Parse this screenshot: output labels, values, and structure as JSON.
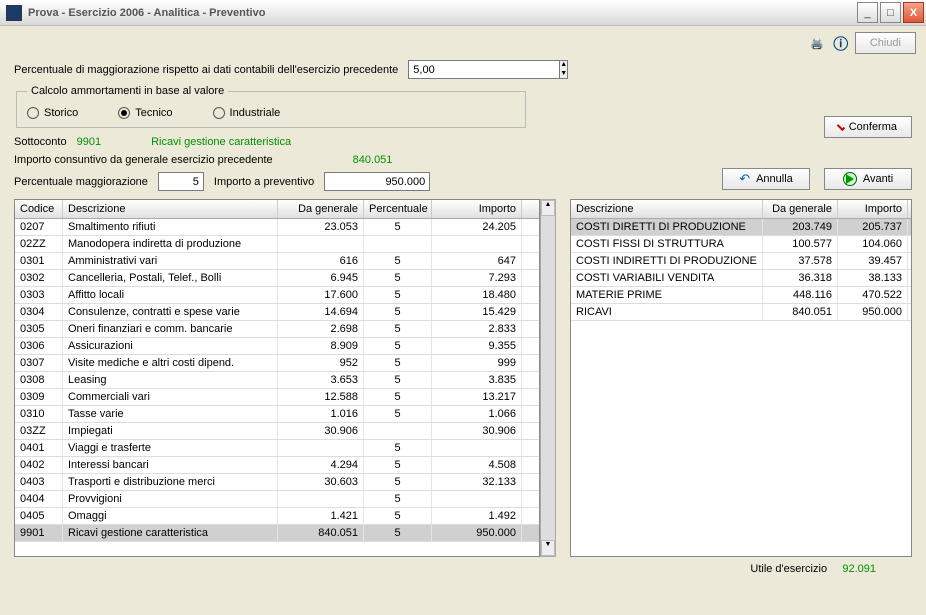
{
  "window": {
    "title": "Prova - Esercizio 2006 - Analitica - Preventivo"
  },
  "toolbar": {
    "chiudi": "Chiudi"
  },
  "form": {
    "perc_label": "Percentuale di maggiorazione rispetto ai dati contabili dell'esercizio precedente",
    "perc_value": "5,00",
    "fieldset_legend": "Calcolo ammortamenti in base al valore",
    "radio_storico": "Storico",
    "radio_tecnico": "Tecnico",
    "radio_industriale": "Industriale",
    "sottoconto_label": "Sottoconto",
    "sottoconto_code": "9901",
    "sottoconto_desc": "Ricavi gestione caratteristica",
    "importo_consuntivo_label": "Importo consuntivo da generale esercizio precedente",
    "importo_consuntivo_value": "840.051",
    "perc_magg_label": "Percentuale maggiorazione",
    "perc_magg_value": "5",
    "importo_prev_label": "Importo a preventivo",
    "importo_prev_value": "950.000"
  },
  "buttons": {
    "conferma": "Conferma",
    "annulla": "Annulla",
    "avanti": "Avanti"
  },
  "left_table": {
    "headers": [
      "Codice",
      "Descrizione",
      "Da generale",
      "Percentuale",
      "Importo"
    ],
    "rows": [
      {
        "c": "0207",
        "d": "Smaltimento rifiuti",
        "g": "23.053",
        "p": "5",
        "i": "24.205"
      },
      {
        "c": "02ZZ",
        "d": "Manodopera indiretta di produzione",
        "g": "",
        "p": "",
        "i": ""
      },
      {
        "c": "0301",
        "d": "Amministrativi vari",
        "g": "616",
        "p": "5",
        "i": "647"
      },
      {
        "c": "0302",
        "d": "Cancelleria, Postali, Telef., Bolli",
        "g": "6.945",
        "p": "5",
        "i": "7.293"
      },
      {
        "c": "0303",
        "d": "Affitto locali",
        "g": "17.600",
        "p": "5",
        "i": "18.480"
      },
      {
        "c": "0304",
        "d": "Consulenze, contratti e spese varie",
        "g": "14.694",
        "p": "5",
        "i": "15.429"
      },
      {
        "c": "0305",
        "d": "Oneri finanziari e comm. bancarie",
        "g": "2.698",
        "p": "5",
        "i": "2.833"
      },
      {
        "c": "0306",
        "d": "Assicurazioni",
        "g": "8.909",
        "p": "5",
        "i": "9.355"
      },
      {
        "c": "0307",
        "d": "Visite mediche e altri costi dipend.",
        "g": "952",
        "p": "5",
        "i": "999"
      },
      {
        "c": "0308",
        "d": "Leasing",
        "g": "3.653",
        "p": "5",
        "i": "3.835"
      },
      {
        "c": "0309",
        "d": "Commerciali vari",
        "g": "12.588",
        "p": "5",
        "i": "13.217"
      },
      {
        "c": "0310",
        "d": "Tasse varie",
        "g": "1.016",
        "p": "5",
        "i": "1.066"
      },
      {
        "c": "03ZZ",
        "d": "Impiegati",
        "g": "30.906",
        "p": "",
        "i": "30.906"
      },
      {
        "c": "0401",
        "d": "Viaggi e trasferte",
        "g": "",
        "p": "5",
        "i": ""
      },
      {
        "c": "0402",
        "d": "Interessi bancari",
        "g": "4.294",
        "p": "5",
        "i": "4.508"
      },
      {
        "c": "0403",
        "d": "Trasporti e distribuzione merci",
        "g": "30.603",
        "p": "5",
        "i": "32.133"
      },
      {
        "c": "0404",
        "d": "Provvigioni",
        "g": "",
        "p": "5",
        "i": ""
      },
      {
        "c": "0405",
        "d": "Omaggi",
        "g": "1.421",
        "p": "5",
        "i": "1.492"
      },
      {
        "c": "9901",
        "d": "Ricavi gestione caratteristica",
        "g": "840.051",
        "p": "5",
        "i": "950.000",
        "sel": true
      }
    ]
  },
  "right_table": {
    "headers": [
      "Descrizione",
      "Da generale",
      "Importo"
    ],
    "rows": [
      {
        "d": "COSTI DIRETTI DI PRODUZIONE",
        "g": "203.749",
        "i": "205.737",
        "sel": true
      },
      {
        "d": "COSTI FISSI DI STRUTTURA",
        "g": "100.577",
        "i": "104.060"
      },
      {
        "d": "COSTI INDIRETTI DI PRODUZIONE",
        "g": "37.578",
        "i": "39.457"
      },
      {
        "d": "COSTI VARIABILI VENDITA",
        "g": "36.318",
        "i": "38.133"
      },
      {
        "d": "MATERIE PRIME",
        "g": "448.116",
        "i": "470.522"
      },
      {
        "d": "RICAVI",
        "g": "840.051",
        "i": "950.000"
      }
    ]
  },
  "footer": {
    "utile_label": "Utile d'esercizio",
    "utile_value": "92.091"
  }
}
